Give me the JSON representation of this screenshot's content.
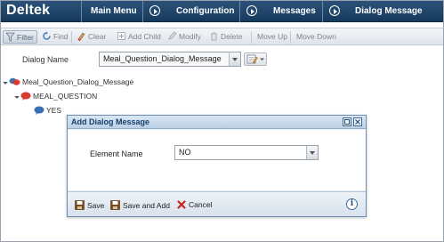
{
  "app": {
    "logo": "Deltek",
    "nav": [
      {
        "label": "Main Menu"
      },
      {
        "label": "Configuration"
      },
      {
        "label": "Messages"
      },
      {
        "label": "Dialog Message"
      }
    ]
  },
  "toolbar": {
    "filter": "Filter",
    "find": "Find",
    "clear": "Clear",
    "add_child": "Add Child",
    "modify": "Modify",
    "delete": "Delete",
    "move_up": "Move Up",
    "move_down": "Move Down"
  },
  "dialog_name": {
    "label": "Dialog Name",
    "value": "Meal_Question_Dialog_Message"
  },
  "tree": {
    "root": "Meal_Question_Dialog_Message",
    "child": "MEAL_QUESTION",
    "leaf": "YES"
  },
  "modal": {
    "title": "Add Dialog Message",
    "field_label": "Element Name",
    "field_value": "NO",
    "buttons": {
      "save": "Save",
      "save_and_add": "Save and Add",
      "cancel": "Cancel"
    },
    "info_glyph": "i"
  },
  "icons": {
    "filter": "filter-icon",
    "find": "find-icon",
    "clear": "clear-icon",
    "add_child": "add-child-icon",
    "modify": "modify-icon",
    "delete": "delete-icon",
    "save": "save-disk-icon",
    "cancel": "cancel-x-icon",
    "info": "info-icon"
  },
  "colors": {
    "nav_bg": "#1f4669",
    "modal_title": "#15406b",
    "cancel_red": "#c8261e"
  }
}
